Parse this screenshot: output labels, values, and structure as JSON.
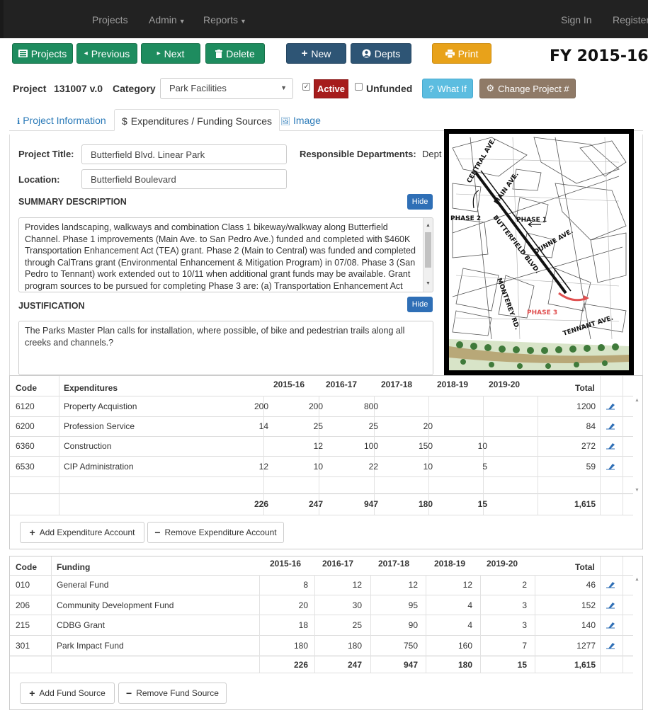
{
  "nav": {
    "projects": "Projects",
    "admin": "Admin",
    "reports": "Reports",
    "sign_in": "Sign In",
    "register": "Register"
  },
  "toolbar": {
    "projects": "Projects",
    "previous": "Previous",
    "next": "Next",
    "delete": "Delete",
    "new": "New",
    "depts": "Depts",
    "print": "Print",
    "fiscal_year": "FY 2015-16"
  },
  "project_bar": {
    "project_label": "Project",
    "project_number": "131007 v.0",
    "category_label": "Category",
    "category_value": "Park Facilities",
    "active_checked": true,
    "active_label": "Active",
    "unfunded_checked": false,
    "unfunded_label": "Unfunded",
    "what_if": "What If",
    "change_project": "Change Project #"
  },
  "tabs": [
    {
      "label": "Project Information",
      "icon": "info-icon"
    },
    {
      "label": "Expenditures / Funding Sources",
      "icon": "dollar-icon",
      "active": true
    },
    {
      "label": "Image",
      "icon": "image-icon"
    }
  ],
  "project_info": {
    "title_label": "Project Title:",
    "title_value": "Butterfield Blvd.  Linear Park",
    "location_label": "Location:",
    "location_value": "Butterfield Boulevard",
    "responsible_label": "Responsible Departments:",
    "responsible_value": "Dept",
    "summary_heading": "SUMMARY DESCRIPTION",
    "summary_hide": "Hide",
    "summary_text": "Provides landscaping, walkways and combination Class 1 bikeway/walkway along Butterfield Channel. Phase 1 improvements (Main Ave. to San Pedro Ave.) funded and completed with $460K Transportation Enhancement Act (TEA) grant. Phase 2 (Main to Central) was funded and completed through CalTrans grant (Environmental Enhancement & Mitigation Program) in 07/08. Phase 3 (San Pedro to Tennant) work extended out to 10/11 when additional grant funds may be available. Grant program sources to be pursued for completing Phase 3 are: (a) Transportation Enhancement Act (TEA), (b) VTA Bicycle Expenditure Program.",
    "justification_heading": "JUSTIFICATION",
    "justification_hide": "Hide",
    "justification_text": "The Parks Master Plan calls for installation, where possible, of bike and pedestrian trails along all creeks and channels.?"
  },
  "map": {
    "labels": {
      "central": "CENTRAL AVE.",
      "main": "MAIN AVE.",
      "phase2": "PHASE 2",
      "phase1": "PHASE 1",
      "butterfield": "BUTTERFIELD BLVD.",
      "dunne": "DUNNE AVE.",
      "monterey": "MONTEREY RD.",
      "phase3": "PHASE 3",
      "tennant": "TENNANT AVE."
    }
  },
  "expenditures": {
    "headers": {
      "code": "Code",
      "name": "Expenditures",
      "total": "Total"
    },
    "years": [
      "2015-16",
      "2016-17",
      "2017-18",
      "2018-19",
      "2019-20"
    ],
    "rows": [
      {
        "code": "6120",
        "name": "Property Acquistion",
        "values": [
          "200",
          "200",
          "800",
          "",
          ""
        ],
        "total": "1200"
      },
      {
        "code": "6200",
        "name": "Profession Service",
        "values": [
          "14",
          "25",
          "25",
          "20",
          ""
        ],
        "total": "84"
      },
      {
        "code": "6360",
        "name": "Construction",
        "values": [
          "",
          "12",
          "100",
          "150",
          "10"
        ],
        "total": "272"
      },
      {
        "code": "6530",
        "name": "CIP Administration",
        "values": [
          "12",
          "10",
          "22",
          "10",
          "5"
        ],
        "total": "59"
      }
    ],
    "totals": [
      "226",
      "247",
      "947",
      "180",
      "15"
    ],
    "grand_total": "1,615",
    "add_button": "Add Expenditure Account",
    "remove_button": "Remove Expenditure Account"
  },
  "funding": {
    "headers": {
      "code": "Code",
      "name": "Funding",
      "total": "Total"
    },
    "years": [
      "2015-16",
      "2016-17",
      "2017-18",
      "2018-19",
      "2019-20"
    ],
    "rows": [
      {
        "code": "010",
        "name": "General Fund",
        "values": [
          "8",
          "12",
          "12",
          "12",
          "2"
        ],
        "total": "46"
      },
      {
        "code": "206",
        "name": "Community Development Fund",
        "values": [
          "20",
          "30",
          "95",
          "4",
          "3"
        ],
        "total": "152"
      },
      {
        "code": "215",
        "name": "CDBG Grant",
        "values": [
          "18",
          "25",
          "90",
          "4",
          "3"
        ],
        "total": "140"
      },
      {
        "code": "301",
        "name": "Park Impact Fund",
        "values": [
          "180",
          "180",
          "750",
          "160",
          "7"
        ],
        "total": "1277"
      }
    ],
    "totals": [
      "226",
      "247",
      "947",
      "180",
      "15"
    ],
    "grand_total": "1,615",
    "add_button": "Add Fund Source",
    "remove_button": "Remove Fund Source"
  },
  "colors": {
    "nav_bg": "#222222",
    "green": "#1e8c5f",
    "navy": "#2e5575",
    "orange": "#e8a21a",
    "active_red": "#a61c1c",
    "link_blue": "#2a7ab8",
    "hide_blue": "#2f6fb6",
    "phase3_red": "#e05050"
  }
}
